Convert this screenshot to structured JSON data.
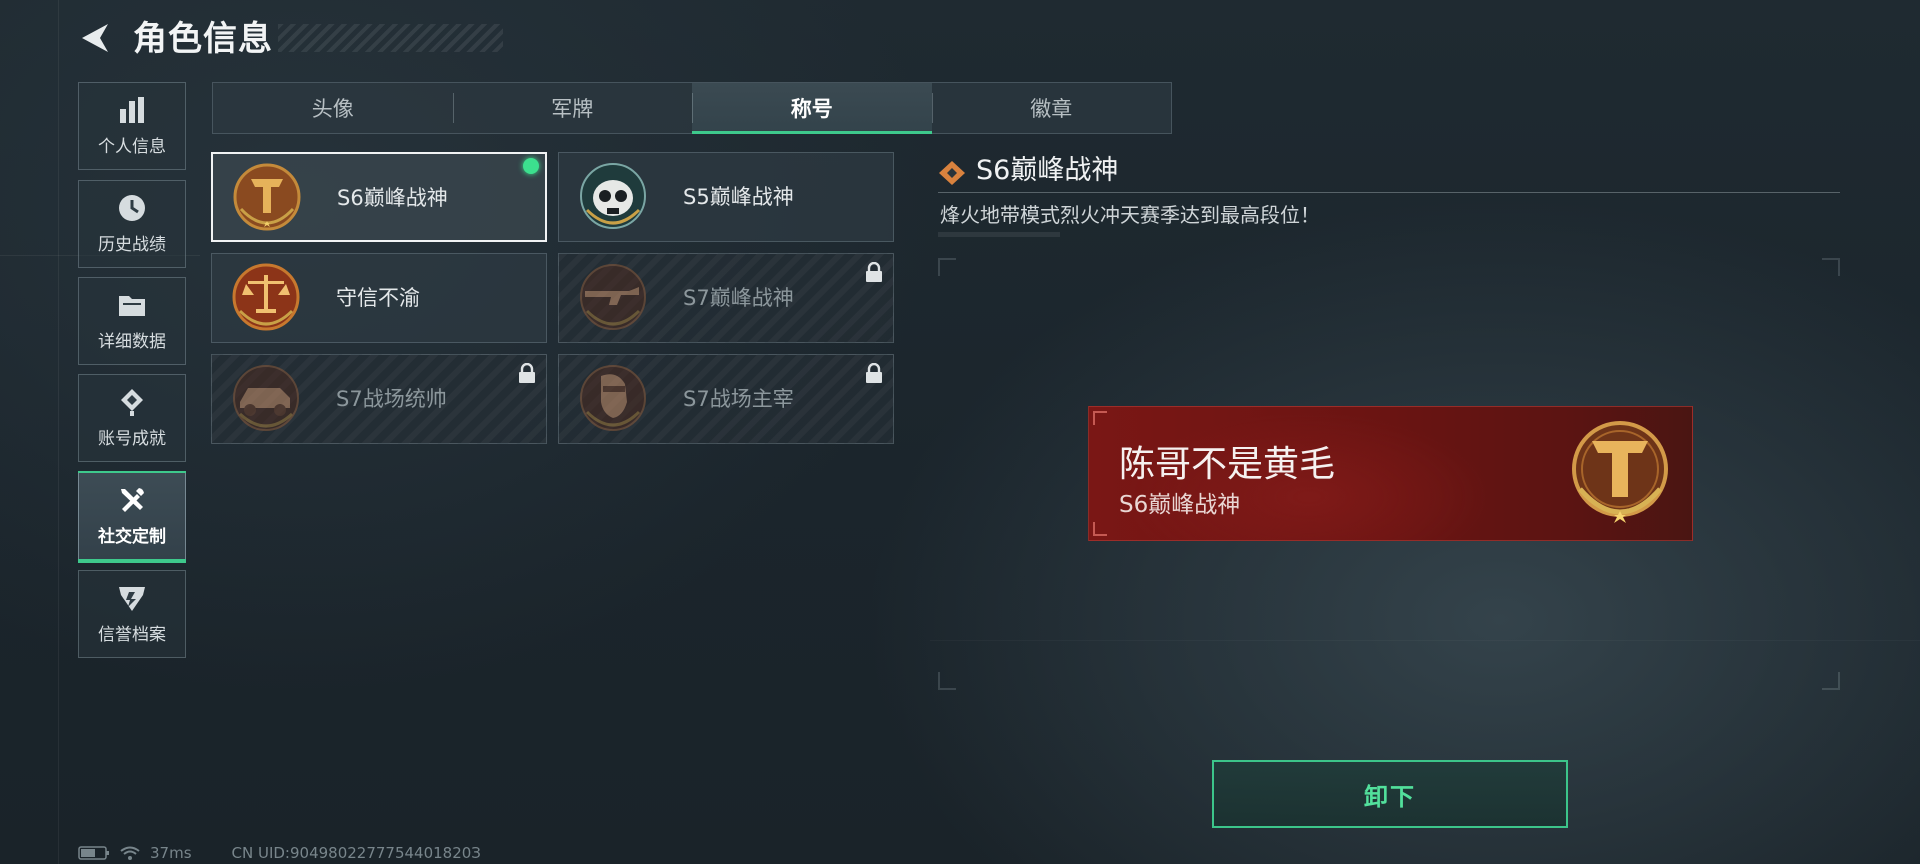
{
  "header": {
    "title": "角色信息",
    "back_icon": "back-arrow-icon"
  },
  "nav": {
    "items": [
      {
        "label": "个人信息",
        "icon": "bar-chart-icon"
      },
      {
        "label": "历史战绩",
        "icon": "clock-icon"
      },
      {
        "label": "详细数据",
        "icon": "folder-icon"
      },
      {
        "label": "账号成就",
        "icon": "achievement-icon"
      },
      {
        "label": "社交定制",
        "icon": "tools-icon",
        "active": true
      },
      {
        "label": "信誉档案",
        "icon": "shield-icon"
      }
    ]
  },
  "tabs": [
    {
      "label": "头像"
    },
    {
      "label": "军牌"
    },
    {
      "label": "称号",
      "active": true
    },
    {
      "label": "徽章"
    }
  ],
  "titles": [
    {
      "label": "S6巅峰战神",
      "emblem": "bronze-t-emblem-icon",
      "selected": true,
      "equipped": true,
      "locked": false
    },
    {
      "label": "S5巅峰战神",
      "emblem": "skull-emblem-icon",
      "selected": false,
      "equipped": false,
      "locked": false
    },
    {
      "label": "守信不渝",
      "emblem": "scales-emblem-icon",
      "selected": false,
      "equipped": false,
      "locked": false
    },
    {
      "label": "S7巅峰战神",
      "emblem": "rifle-emblem-icon",
      "selected": false,
      "equipped": false,
      "locked": true
    },
    {
      "label": "S7战场统帅",
      "emblem": "vehicle-emblem-icon",
      "selected": false,
      "equipped": false,
      "locked": true
    },
    {
      "label": "S7战场主宰",
      "emblem": "soldier-emblem-icon",
      "selected": false,
      "equipped": false,
      "locked": true
    }
  ],
  "detail": {
    "title": "S6巅峰战神",
    "description": "烽火地带模式烈火冲天赛季达到最高段位！"
  },
  "preview": {
    "player_name": "陈哥不是黄毛",
    "title": "S6巅峰战神"
  },
  "actions": {
    "unequip_label": "卸下"
  },
  "footer": {
    "ping": "37ms",
    "uid": "CN UID:9049802277754401820З"
  },
  "colors": {
    "accent": "#3ec98c",
    "equipped": "#3ce08e",
    "banner": "#7a1715"
  }
}
